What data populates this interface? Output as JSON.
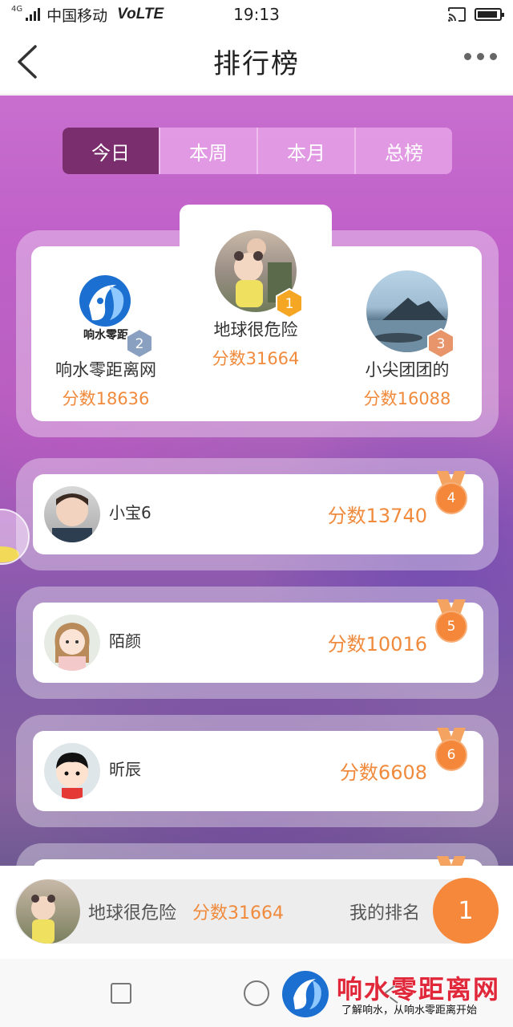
{
  "status_bar": {
    "network_tag": "4G",
    "carrier": "中国移动",
    "volte": "VoLTE",
    "time": "19:13"
  },
  "nav": {
    "title": "排行榜"
  },
  "tabs": [
    {
      "label": "今日",
      "active": true
    },
    {
      "label": "本周",
      "active": false
    },
    {
      "label": "本月",
      "active": false
    },
    {
      "label": "总榜",
      "active": false
    }
  ],
  "podium": {
    "first": {
      "rank": "1",
      "name": "地球很危险",
      "score": "分数31664"
    },
    "second": {
      "rank": "2",
      "name": "响水零距离网",
      "score": "分数18636",
      "logo_text": "响水零距"
    },
    "third": {
      "rank": "3",
      "name": "小尖团团的",
      "score": "分数16088"
    }
  },
  "list": [
    {
      "rank": "4",
      "name": "小宝6",
      "score": "分数13740"
    },
    {
      "rank": "5",
      "name": "陌颜",
      "score": "分数10016"
    },
    {
      "rank": "6",
      "name": "昕辰",
      "score": "分数6608"
    }
  ],
  "my_rank": {
    "name": "地球很危险",
    "score": "分数31664",
    "label": "我的排名",
    "rank": "1"
  },
  "watermark": {
    "title": "响水零距离网",
    "subtitle": "了解响水，从响水零距离开始"
  },
  "colors": {
    "accent_orange": "#f08a3c",
    "tab_active": "#7b2e6d",
    "medal_gold": "#f5a623",
    "medal_silver": "#8aa0c0",
    "medal_bronze": "#e8956b"
  }
}
